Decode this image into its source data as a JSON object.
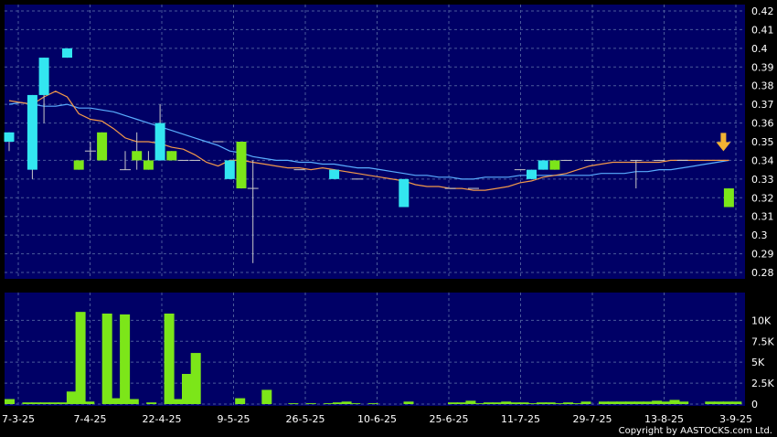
{
  "colors": {
    "background": "#000000",
    "plot_bg": "#000066",
    "grid": "#4a5a9a",
    "up": "#33e6f0",
    "down": "#7ce619",
    "ma_short": "#f2994a",
    "ma_long": "#5aaeff",
    "volume": "#7ce619",
    "arrow": "#f2b233",
    "text": "#ffffff"
  },
  "copyright": "Copyright by AASTOCKS.com Ltd.",
  "chart_data": [
    {
      "type": "candlestick",
      "ylim": [
        0.28,
        0.42
      ],
      "yticks": [
        "0.28",
        "0.29",
        "0.3",
        "0.31",
        "0.32",
        "0.33",
        "0.34",
        "0.35",
        "0.36",
        "0.37",
        "0.38",
        "0.39",
        "0.4",
        "0.41",
        "0.42"
      ],
      "xticks": [
        "7-3-25",
        "7-4-25",
        "22-4-25",
        "9-5-25",
        "26-5-25",
        "10-6-25",
        "25-6-25",
        "11-7-25",
        "29-7-25",
        "13-8-25",
        "3-9-25"
      ],
      "marker": "down-arrow-at-latest",
      "candles": [
        {
          "i": 0,
          "o": 0.35,
          "h": 0.355,
          "l": 0.345,
          "c": 0.355
        },
        {
          "i": 2,
          "o": 0.335,
          "h": 0.375,
          "l": 0.33,
          "c": 0.375
        },
        {
          "i": 3,
          "o": 0.375,
          "h": 0.395,
          "l": 0.36,
          "c": 0.395
        },
        {
          "i": 5,
          "o": 0.395,
          "h": 0.4,
          "l": 0.395,
          "c": 0.4
        },
        {
          "i": 6,
          "o": 0.34,
          "h": 0.34,
          "l": 0.335,
          "c": 0.335
        },
        {
          "i": 7,
          "o": 0.345,
          "h": 0.35,
          "l": 0.34,
          "c": 0.345
        },
        {
          "i": 8,
          "o": 0.355,
          "h": 0.355,
          "l": 0.34,
          "c": 0.34
        },
        {
          "i": 10,
          "o": 0.335,
          "h": 0.345,
          "l": 0.335,
          "c": 0.335
        },
        {
          "i": 11,
          "o": 0.345,
          "h": 0.355,
          "l": 0.335,
          "c": 0.34
        },
        {
          "i": 12,
          "o": 0.34,
          "h": 0.345,
          "l": 0.335,
          "c": 0.335
        },
        {
          "i": 13,
          "o": 0.34,
          "h": 0.37,
          "l": 0.34,
          "c": 0.36
        },
        {
          "i": 14,
          "o": 0.345,
          "h": 0.345,
          "l": 0.34,
          "c": 0.34
        },
        {
          "i": 15,
          "o": 0.34,
          "h": 0.34,
          "l": 0.34,
          "c": 0.34
        },
        {
          "i": 16,
          "o": 0.34,
          "h": 0.34,
          "l": 0.34,
          "c": 0.34
        },
        {
          "i": 18,
          "o": 0.35,
          "h": 0.35,
          "l": 0.35,
          "c": 0.35
        },
        {
          "i": 19,
          "o": 0.33,
          "h": 0.34,
          "l": 0.33,
          "c": 0.34
        },
        {
          "i": 20,
          "o": 0.35,
          "h": 0.35,
          "l": 0.325,
          "c": 0.325
        },
        {
          "i": 21,
          "o": 0.325,
          "h": 0.34,
          "l": 0.285,
          "c": 0.325
        },
        {
          "i": 25,
          "o": 0.335,
          "h": 0.335,
          "l": 0.335,
          "c": 0.335
        },
        {
          "i": 28,
          "o": 0.33,
          "h": 0.335,
          "l": 0.33,
          "c": 0.335
        },
        {
          "i": 30,
          "o": 0.33,
          "h": 0.33,
          "l": 0.33,
          "c": 0.33
        },
        {
          "i": 34,
          "o": 0.315,
          "h": 0.33,
          "l": 0.315,
          "c": 0.33
        },
        {
          "i": 38,
          "o": 0.325,
          "h": 0.325,
          "l": 0.325,
          "c": 0.325
        },
        {
          "i": 40,
          "o": 0.325,
          "h": 0.325,
          "l": 0.325,
          "c": 0.325
        },
        {
          "i": 44,
          "o": 0.335,
          "h": 0.335,
          "l": 0.335,
          "c": 0.335
        },
        {
          "i": 45,
          "o": 0.33,
          "h": 0.335,
          "l": 0.33,
          "c": 0.335
        },
        {
          "i": 46,
          "o": 0.335,
          "h": 0.34,
          "l": 0.335,
          "c": 0.34
        },
        {
          "i": 47,
          "o": 0.34,
          "h": 0.34,
          "l": 0.335,
          "c": 0.335
        },
        {
          "i": 48,
          "o": 0.34,
          "h": 0.34,
          "l": 0.34,
          "c": 0.34
        },
        {
          "i": 50,
          "o": 0.34,
          "h": 0.34,
          "l": 0.34,
          "c": 0.34
        },
        {
          "i": 54,
          "o": 0.34,
          "h": 0.34,
          "l": 0.325,
          "c": 0.34
        },
        {
          "i": 56,
          "o": 0.34,
          "h": 0.34,
          "l": 0.34,
          "c": 0.34
        },
        {
          "i": 58,
          "o": 0.34,
          "h": 0.34,
          "l": 0.34,
          "c": 0.34
        },
        {
          "i": 62,
          "o": 0.325,
          "h": 0.325,
          "l": 0.315,
          "c": 0.315
        }
      ],
      "ma_short": [
        0.372,
        0.371,
        0.37,
        0.374,
        0.377,
        0.374,
        0.365,
        0.362,
        0.361,
        0.357,
        0.352,
        0.35,
        0.35,
        0.349,
        0.347,
        0.346,
        0.343,
        0.339,
        0.337,
        0.34,
        0.34,
        0.339,
        0.338,
        0.337,
        0.336,
        0.336,
        0.335,
        0.336,
        0.335,
        0.334,
        0.333,
        0.332,
        0.331,
        0.33,
        0.329,
        0.327,
        0.326,
        0.326,
        0.325,
        0.325,
        0.324,
        0.324,
        0.325,
        0.326,
        0.328,
        0.329,
        0.331,
        0.332,
        0.333,
        0.335,
        0.337,
        0.338,
        0.339,
        0.339,
        0.339,
        0.339,
        0.339,
        0.34,
        0.34,
        0.34,
        0.34,
        0.34,
        0.34
      ],
      "ma_long": [
        0.37,
        0.371,
        0.37,
        0.369,
        0.369,
        0.37,
        0.368,
        0.368,
        0.367,
        0.366,
        0.364,
        0.362,
        0.36,
        0.358,
        0.356,
        0.354,
        0.352,
        0.35,
        0.348,
        0.345,
        0.344,
        0.342,
        0.341,
        0.34,
        0.34,
        0.339,
        0.339,
        0.338,
        0.338,
        0.337,
        0.336,
        0.336,
        0.335,
        0.334,
        0.333,
        0.332,
        0.332,
        0.331,
        0.331,
        0.33,
        0.33,
        0.331,
        0.331,
        0.331,
        0.332,
        0.332,
        0.332,
        0.332,
        0.332,
        0.332,
        0.332,
        0.333,
        0.333,
        0.333,
        0.334,
        0.334,
        0.335,
        0.335,
        0.336,
        0.337,
        0.338,
        0.339,
        0.34
      ]
    },
    {
      "type": "bar",
      "ylim": [
        0,
        12000
      ],
      "yticks": [
        "0",
        "2.5K",
        "5K",
        "7.5K",
        "10K"
      ],
      "values": [
        600,
        0,
        200,
        200,
        200,
        200,
        200,
        1500,
        11000,
        300,
        0,
        10800,
        700,
        10700,
        600,
        0,
        200,
        0,
        10800,
        600,
        3600,
        6100,
        0,
        0,
        0,
        0,
        700,
        0,
        0,
        1700,
        0,
        0,
        100,
        0,
        100,
        0,
        100,
        200,
        300,
        100,
        0,
        100,
        0,
        0,
        0,
        300,
        0,
        0,
        0,
        0,
        200,
        200,
        400,
        100,
        200,
        200,
        300,
        200,
        200,
        100,
        200,
        200,
        100,
        200,
        100,
        300,
        0,
        300,
        300,
        300,
        300,
        300,
        300,
        400,
        300,
        500,
        300,
        0,
        0,
        300,
        300,
        300,
        300
      ]
    }
  ]
}
